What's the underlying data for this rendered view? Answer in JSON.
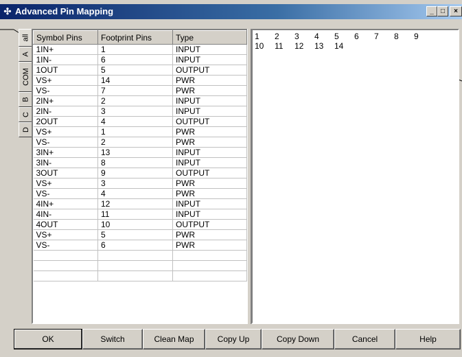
{
  "window": {
    "title": "Advanced Pin Mapping",
    "minimize_glyph": "_",
    "maximize_glyph": "□",
    "close_glyph": "×"
  },
  "tabs": [
    {
      "label": "all",
      "selected": true
    },
    {
      "label": "A",
      "selected": false
    },
    {
      "label": "COM",
      "selected": false
    },
    {
      "label": "B",
      "selected": false
    },
    {
      "label": "C",
      "selected": false
    },
    {
      "label": "D",
      "selected": false
    }
  ],
  "table": {
    "headers": [
      "Symbol Pins",
      "Footprint Pins",
      "Type"
    ],
    "rows": [
      [
        "1IN+",
        "1",
        "INPUT"
      ],
      [
        "1IN-",
        "6",
        "INPUT"
      ],
      [
        "1OUT",
        "5",
        "OUTPUT"
      ],
      [
        "VS+",
        "14",
        "PWR"
      ],
      [
        "VS-",
        "7",
        "PWR"
      ],
      [
        "2IN+",
        "2",
        "INPUT"
      ],
      [
        "2IN-",
        "3",
        "INPUT"
      ],
      [
        "2OUT",
        "4",
        "OUTPUT"
      ],
      [
        "VS+",
        "1",
        "PWR"
      ],
      [
        "VS-",
        "2",
        "PWR"
      ],
      [
        "3IN+",
        "13",
        "INPUT"
      ],
      [
        "3IN-",
        "8",
        "INPUT"
      ],
      [
        "3OUT",
        "9",
        "OUTPUT"
      ],
      [
        "VS+",
        "3",
        "PWR"
      ],
      [
        "VS-",
        "4",
        "PWR"
      ],
      [
        "4IN+",
        "12",
        "INPUT"
      ],
      [
        "4IN-",
        "11",
        "INPUT"
      ],
      [
        "4OUT",
        "10",
        "OUTPUT"
      ],
      [
        "VS+",
        "5",
        "PWR"
      ],
      [
        "VS-",
        "6",
        "PWR"
      ],
      [
        "",
        "",
        ""
      ],
      [
        "",
        "",
        ""
      ],
      [
        "",
        "",
        ""
      ]
    ]
  },
  "footprint_pins": [
    "1",
    "2",
    "3",
    "4",
    "5",
    "6",
    "7",
    "8",
    "9",
    "10",
    "11",
    "12",
    "13",
    "14"
  ],
  "buttons": {
    "ok": "OK",
    "switch": "Switch",
    "clean_map": "Clean Map",
    "copy_up": "Copy Up",
    "copy_down": "Copy Down",
    "cancel": "Cancel",
    "help": "Help"
  },
  "icons": {
    "app": "pin-mapping-icon",
    "title_gradient_start": "#0a246a",
    "title_gradient_end": "#a6caf0"
  }
}
